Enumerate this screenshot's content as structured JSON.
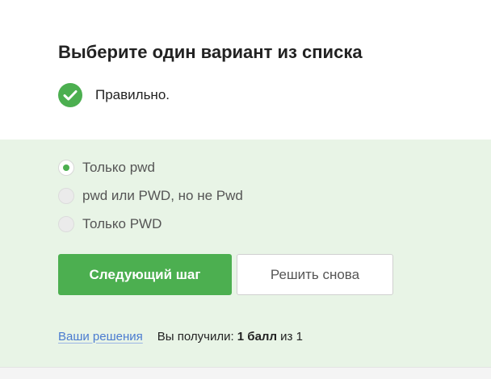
{
  "quiz": {
    "title": "Выберите один вариант из списка",
    "status": {
      "text": "Правильно.",
      "icon": "check-circle-icon",
      "color": "#4caf50"
    },
    "options": [
      {
        "label": "Только pwd",
        "selected": true
      },
      {
        "label": "pwd или PWD, но не Pwd",
        "selected": false
      },
      {
        "label": "Только PWD",
        "selected": false
      }
    ],
    "buttons": {
      "next_label": "Следующий шаг",
      "retry_label": "Решить снова"
    },
    "footer": {
      "solutions_link": "Ваши решения",
      "score_prefix": "Вы получили:",
      "score_value": "1 балл",
      "score_suffix": "из 1"
    }
  },
  "colors": {
    "accent": "#4caf50",
    "panel_background": "#e8f4e6",
    "link": "#4a7bd0"
  }
}
